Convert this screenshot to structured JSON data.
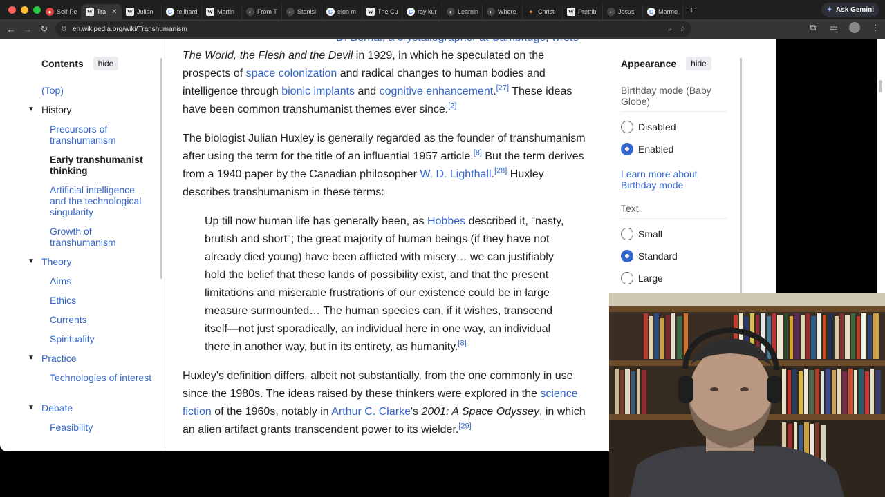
{
  "browser": {
    "tabs": [
      {
        "label": "Self-Pe",
        "icon": "red"
      },
      {
        "label": "Tra",
        "icon": "w",
        "active": true
      },
      {
        "label": "Julian",
        "icon": "w"
      },
      {
        "label": "teilhard",
        "icon": "g"
      },
      {
        "label": "Martin",
        "icon": "w"
      },
      {
        "label": "From T",
        "icon": "dark"
      },
      {
        "label": "Stanisl",
        "icon": "dark"
      },
      {
        "label": "elon m",
        "icon": "g"
      },
      {
        "label": "The Cu",
        "icon": "w"
      },
      {
        "label": "ray kur",
        "icon": "g"
      },
      {
        "label": "Learnin",
        "icon": "dark"
      },
      {
        "label": "Where",
        "icon": "dark"
      },
      {
        "label": "Christi",
        "icon": "orange"
      },
      {
        "label": "Pretrib",
        "icon": "w"
      },
      {
        "label": "Jesus",
        "icon": "dark"
      },
      {
        "label": "Mormo",
        "icon": "g"
      }
    ],
    "new_tab": "+",
    "gemini_label": "Ask Gemini",
    "url": "en.wikipedia.org/wiki/Transhumanism"
  },
  "toc": {
    "title": "Contents",
    "hide": "hide",
    "items": {
      "top": "(Top)",
      "history": "History",
      "precursors": "Precursors of transhumanism",
      "early": "Early transhumanist thinking",
      "ai": "Artificial intelligence and the technological singularity",
      "growth": "Growth of transhumanism",
      "theory": "Theory",
      "aims": "Aims",
      "ethics": "Ethics",
      "currents": "Currents",
      "spirituality": "Spirituality",
      "practice": "Practice",
      "technologies": "Technologies of interest",
      "debate": "Debate",
      "feasibility": "Feasibility"
    }
  },
  "article": {
    "p0": {
      "cut": "D. Bernal, a crystallographer at Cambridge, wrote",
      "l1_italic": "The World, the Flesh and the Devil",
      "l1_rest": " in 1929, in which he speculated on the",
      "l2_a": "prospects of ",
      "l2_link": "space colonization",
      "l2_b": " and radical changes to human bodies and",
      "l3_a": "intelligence through ",
      "l3_link1": "bionic implants",
      "l3_b": " and ",
      "l3_link2": "cognitive enhancement",
      "l3_c": ".",
      "l3_ref": "[27]",
      "l3_d": " These ideas",
      "l4_a": "have been common transhumanist themes ever since.",
      "l4_ref": "[2]"
    },
    "p1": {
      "l1": "The biologist Julian Huxley is generally regarded as the founder of transhumanism",
      "l2_a": "after using the term for the title of an influential 1957 article.",
      "l2_ref": "[8]",
      "l2_b": " But the term derives",
      "l3_a": "from a 1940 paper by the Canadian philosopher ",
      "l3_link": "W. D. Lighthall",
      "l3_b": ".",
      "l3_ref": "[28]",
      "l3_c": " Huxley",
      "l4": "describes transhumanism in these terms:"
    },
    "quote": {
      "l1_a": "Up till now human life has generally been, as ",
      "l1_link": "Hobbes",
      "l1_b": " described it, \"nasty,",
      "l2": "brutish and short\"; the great majority of human beings (if they have not",
      "l3": "already died young) have been afflicted with misery… we can justifiably",
      "l4": "hold the belief that these lands of possibility exist, and that the present",
      "l5": "limitations and miserable frustrations of our existence could be in large",
      "l6": "measure surmounted… The human species can, if it wishes, transcend",
      "l7": "itself—not just sporadically, an individual here in one way, an individual",
      "l8": "there in another way, but in its entirety, as humanity.",
      "l8_ref": "[8]"
    },
    "p2": {
      "l1": "Huxley's definition differs, albeit not substantially, from the one commonly in use",
      "l2_a": "since the 1980s. The ideas raised by these thinkers were explored in the ",
      "l2_link": "science",
      "l3_link1": "fiction",
      "l3_a": " of the 1960s, notably in ",
      "l3_link2": "Arthur C. Clarke",
      "l3_b": "'s ",
      "l3_italic": "2001: A Space Odyssey",
      "l3_c": ", in which",
      "l4_a": "an alien artifact grants transcendent power to its wielder.",
      "l4_ref": "[29]"
    }
  },
  "appearance": {
    "title": "Appearance",
    "hide": "hide",
    "birthday_label": "Birthday mode (Baby Globe)",
    "disabled": "Disabled",
    "enabled": "Enabled",
    "birthday_selected": "Enabled",
    "learn_more": "Learn more about Birthday mode",
    "text_label": "Text",
    "small": "Small",
    "standard": "Standard",
    "large": "Large",
    "text_selected": "Standard"
  },
  "colors": {
    "link": "#3366cc",
    "text": "#202122",
    "chrome_bg": "#1f1f1f"
  }
}
